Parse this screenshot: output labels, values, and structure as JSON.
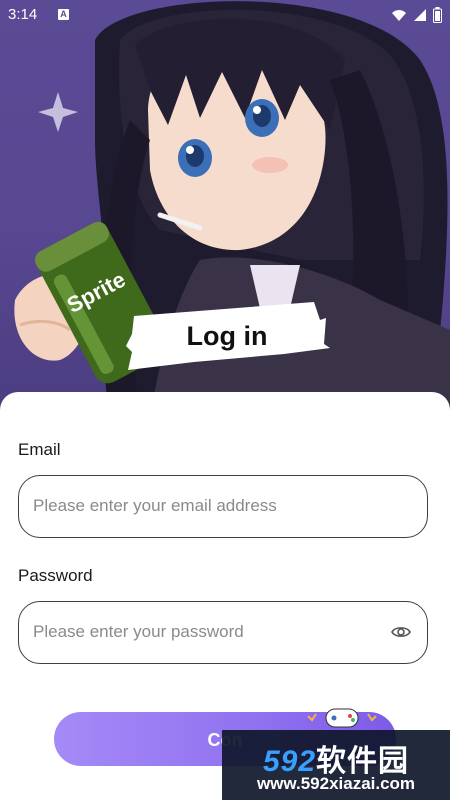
{
  "status_bar": {
    "time": "3:14",
    "app_icon": "A"
  },
  "header": {
    "title": "Log in"
  },
  "form": {
    "email": {
      "label": "Email",
      "placeholder": "Please enter your email address",
      "value": ""
    },
    "password": {
      "label": "Password",
      "placeholder": "Please enter your password",
      "value": ""
    },
    "continue_label": "Con"
  },
  "watermark": {
    "brand_num": "592",
    "brand_text": "软件园",
    "url": "www.592xiazai.com"
  },
  "icons": {
    "wifi": "wifi-icon",
    "signal": "signal-icon",
    "battery": "battery-icon",
    "visibility": "eye-icon",
    "gamepad": "gamepad-icon"
  },
  "colors": {
    "hero_bg": "#5b4a95",
    "button_start": "#a58af7",
    "button_end": "#7c5ce8",
    "input_border": "#3f3f3f"
  }
}
